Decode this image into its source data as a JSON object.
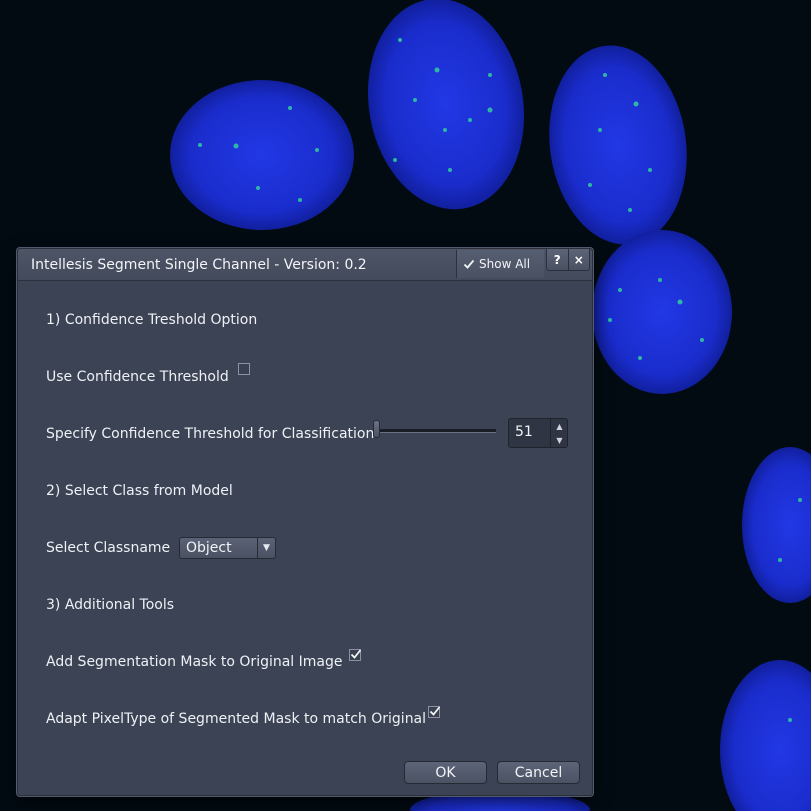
{
  "dialog": {
    "title": "Intellesis Segment Single Channel - Version: 0.2",
    "show_all_label": "Show All",
    "help_label": "?",
    "close_label": "×"
  },
  "sections": {
    "confidence_heading": "1) Confidence Treshold Option",
    "class_heading": "2) Select Class from Model",
    "tools_heading": "3) Additional Tools"
  },
  "fields": {
    "use_confidence": {
      "label": "Use Confidence Threshold",
      "checked": false
    },
    "confidence_threshold": {
      "label": "Specify Confidence Threshold for Classification",
      "value": "51"
    },
    "classname": {
      "label": "Select Classname",
      "value": "Object"
    },
    "add_mask": {
      "label": "Add Segmentation Mask to Original Image",
      "checked": true
    },
    "adapt_pixeltype": {
      "label": "Adapt PixelType of Segmented Mask to match Original",
      "checked": true
    }
  },
  "buttons": {
    "ok": "OK",
    "cancel": "Cancel"
  },
  "icons": {
    "showall_icon": "checkmark-icon",
    "spin_up": "arrow-up-icon",
    "spin_down": "arrow-down-icon",
    "select_arrow": "chevron-down-icon"
  },
  "colors": {
    "dialog_bg": "#3c4354",
    "nucleus": "#1a2fd0",
    "spot": "#2fd0a0"
  }
}
